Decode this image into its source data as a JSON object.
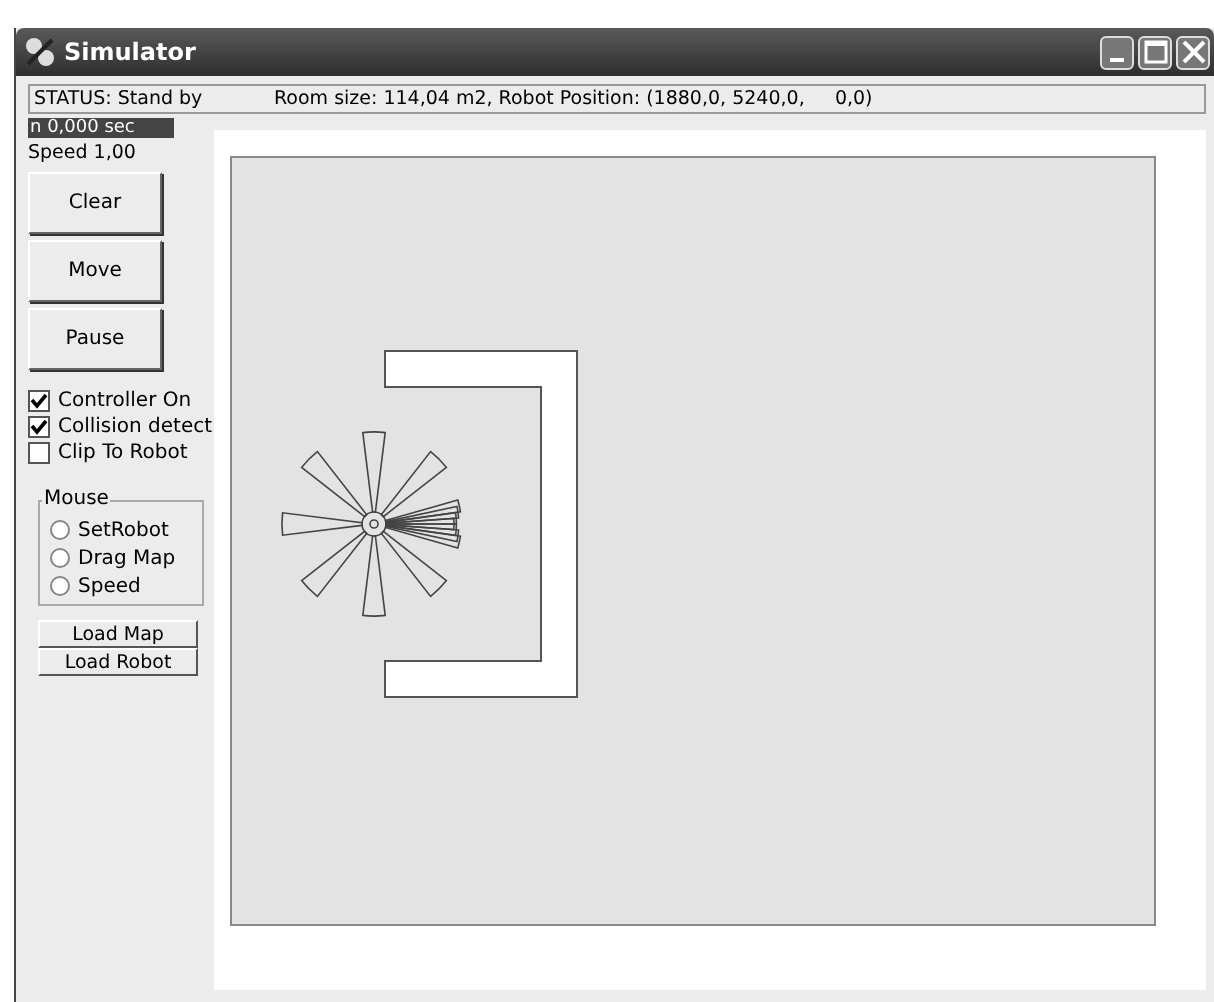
{
  "window": {
    "title": "Simulator"
  },
  "status_bar": {
    "status": "STATUS: Stand by",
    "info": "Room size: 114,04 m2, Robot Position: (1880,0, 5240,0,     0,0)"
  },
  "time_label": "n  0,000 sec",
  "speed_label": "Speed  1,00",
  "buttons": [
    "Clear",
    "Move",
    "Pause"
  ],
  "checkboxes": [
    {
      "label": "Controller On",
      "checked": true
    },
    {
      "label": "Collision detect",
      "checked": true
    },
    {
      "label": "Clip To Robot",
      "checked": false
    }
  ],
  "mouse_group": {
    "title": "Mouse",
    "options": [
      {
        "label": "SetRobot",
        "selected": false
      },
      {
        "label": "Drag Map",
        "selected": false
      },
      {
        "label": "Speed",
        "selected": false
      }
    ]
  },
  "load_buttons": [
    "Load Map",
    "Load Robot"
  ]
}
